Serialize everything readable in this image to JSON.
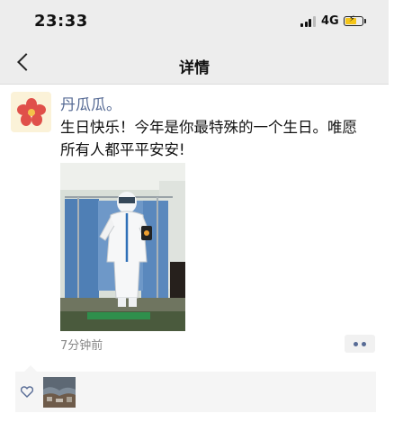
{
  "status_bar": {
    "time": "23:33",
    "network": "4G"
  },
  "nav": {
    "title": "详情"
  },
  "post": {
    "username": "丹瓜瓜。",
    "text": "生日快乐！今年是你最特殊的一个生日。唯愿所有人都平平安安!",
    "time_ago": "7分钟前"
  },
  "colors": {
    "link": "#576b95",
    "nav_bg": "#ededed",
    "comment_bg": "#f5f5f5"
  },
  "icons": [
    "back-icon",
    "signal-icon",
    "battery-icon",
    "heart-icon",
    "more-icon"
  ]
}
